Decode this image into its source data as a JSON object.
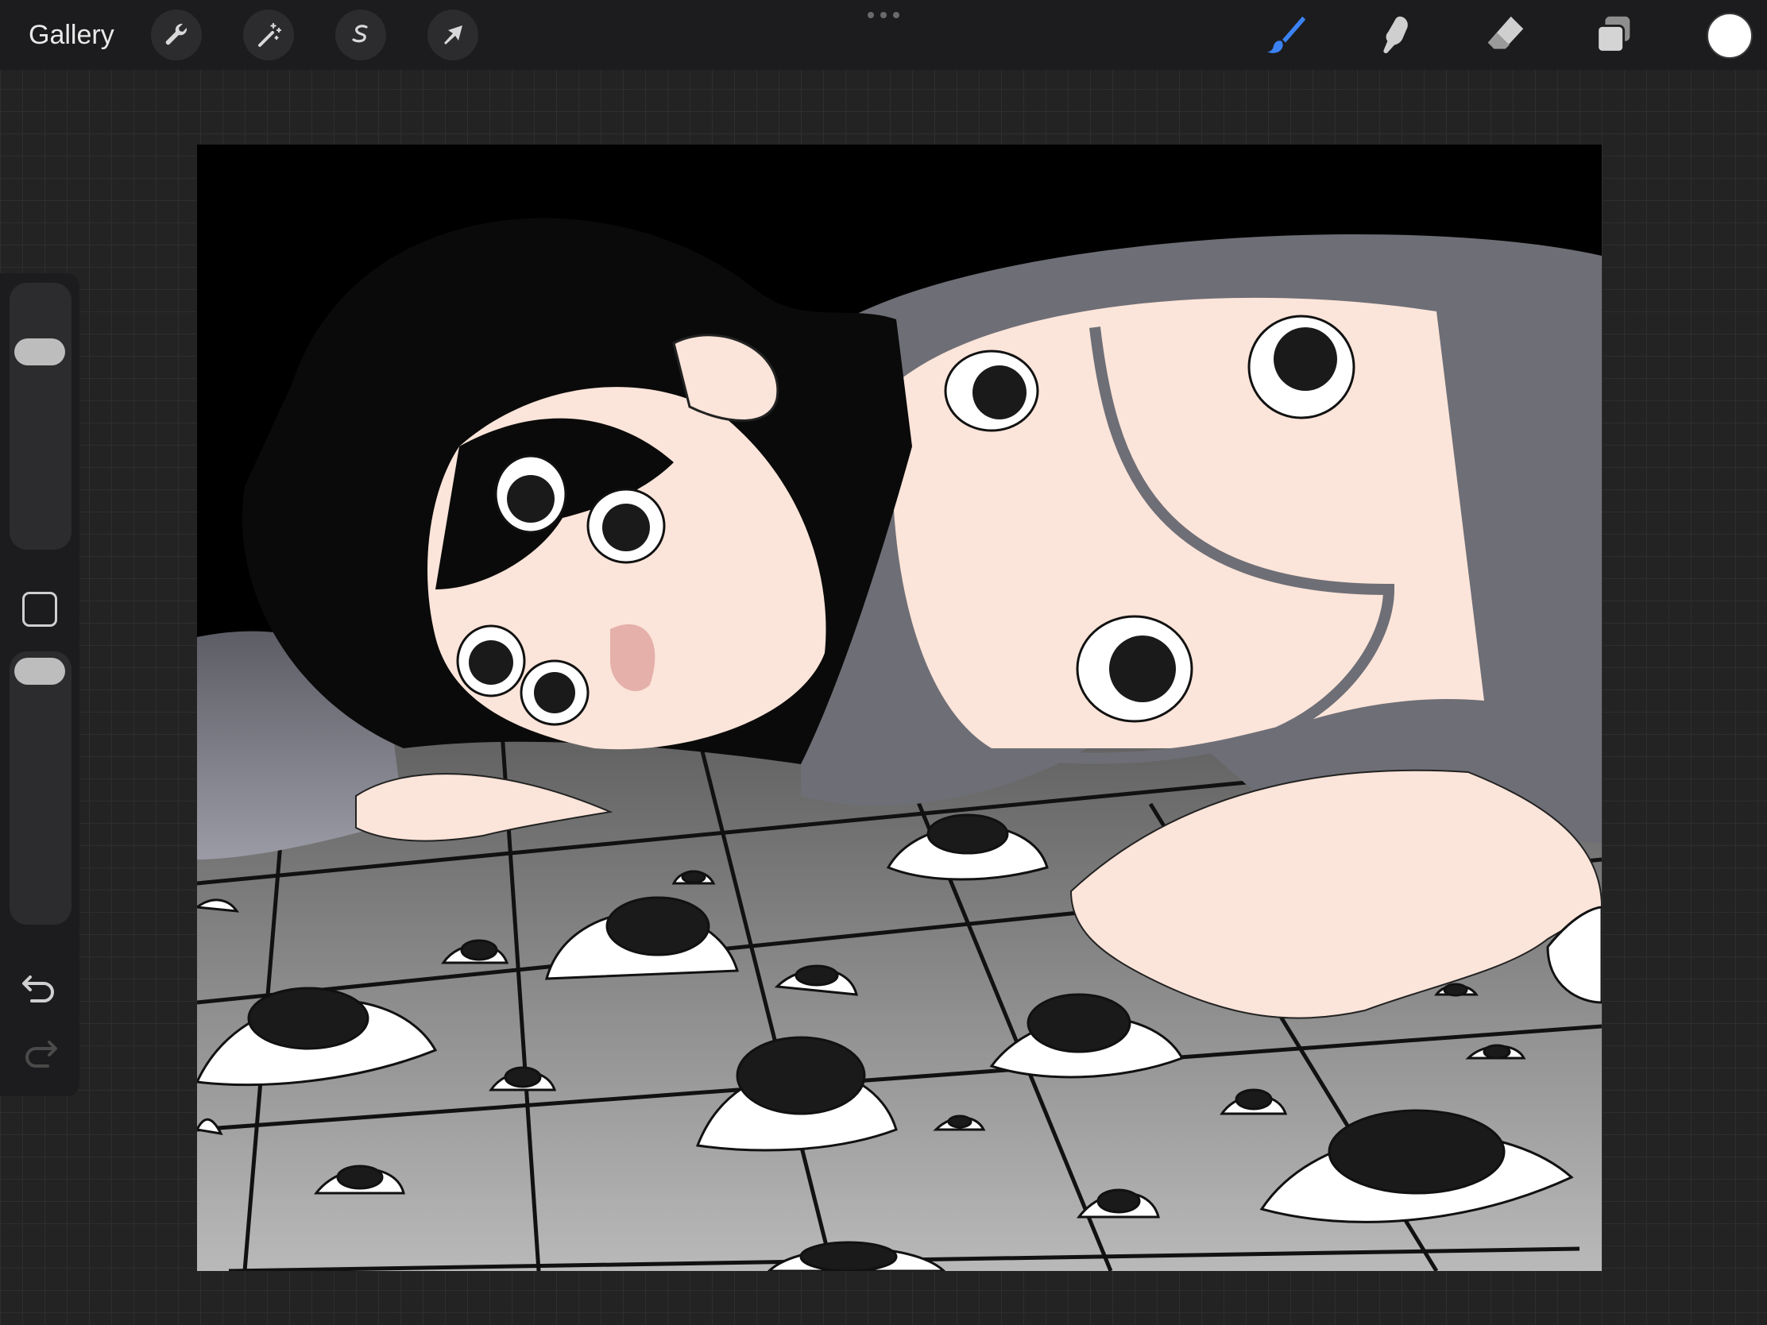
{
  "topbar": {
    "gallery_label": "Gallery",
    "left_tools": [
      {
        "name": "actions",
        "icon": "wrench-icon"
      },
      {
        "name": "adjustments",
        "icon": "magic-wand-icon"
      },
      {
        "name": "selection",
        "icon": "selection-s-icon"
      },
      {
        "name": "transform",
        "icon": "arrow-cursor-icon"
      }
    ],
    "right_tools": [
      {
        "name": "brush",
        "icon": "brush-icon",
        "active": true
      },
      {
        "name": "smudge",
        "icon": "smudge-finger-icon",
        "active": false
      },
      {
        "name": "eraser",
        "icon": "eraser-icon",
        "active": false
      },
      {
        "name": "layers",
        "icon": "layers-icon",
        "active": false
      }
    ],
    "current_color": "#ffffff",
    "accent_color": "#3b82f6"
  },
  "sidebar": {
    "brush_size_level": 0.72,
    "opacity_level": 0.95,
    "icons": [
      "square-modify-icon",
      "undo-icon",
      "redo-icon"
    ]
  },
  "canvas": {
    "artwork": "illustration-canvas"
  }
}
